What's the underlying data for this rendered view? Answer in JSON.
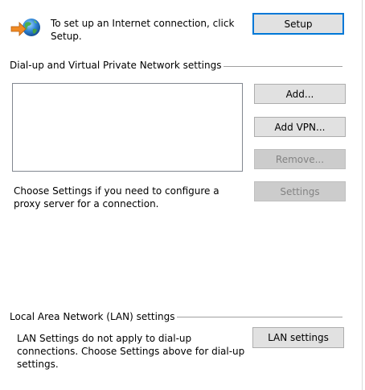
{
  "intro": {
    "text": "To set up an Internet connection, click Setup.",
    "setup_label": "Setup"
  },
  "dialup_group": {
    "title": "Dial-up and Virtual Private Network settings",
    "connections": [],
    "add_label": "Add...",
    "add_vpn_label": "Add VPN...",
    "remove_label": "Remove...",
    "settings_label": "Settings",
    "proxy_note": "Choose Settings if you need to configure a proxy server for a connection."
  },
  "lan_group": {
    "title": "Local Area Network (LAN) settings",
    "note": "LAN Settings do not apply to dial-up connections. Choose Settings above for dial-up settings.",
    "lan_settings_label": "LAN settings"
  },
  "icons": {
    "connection_wizard": "globe-with-arrow-icon"
  },
  "colors": {
    "accent": "#0078d7",
    "button_face": "#e1e1e1",
    "button_disabled": "#cccccc",
    "disabled_text": "#838383"
  }
}
